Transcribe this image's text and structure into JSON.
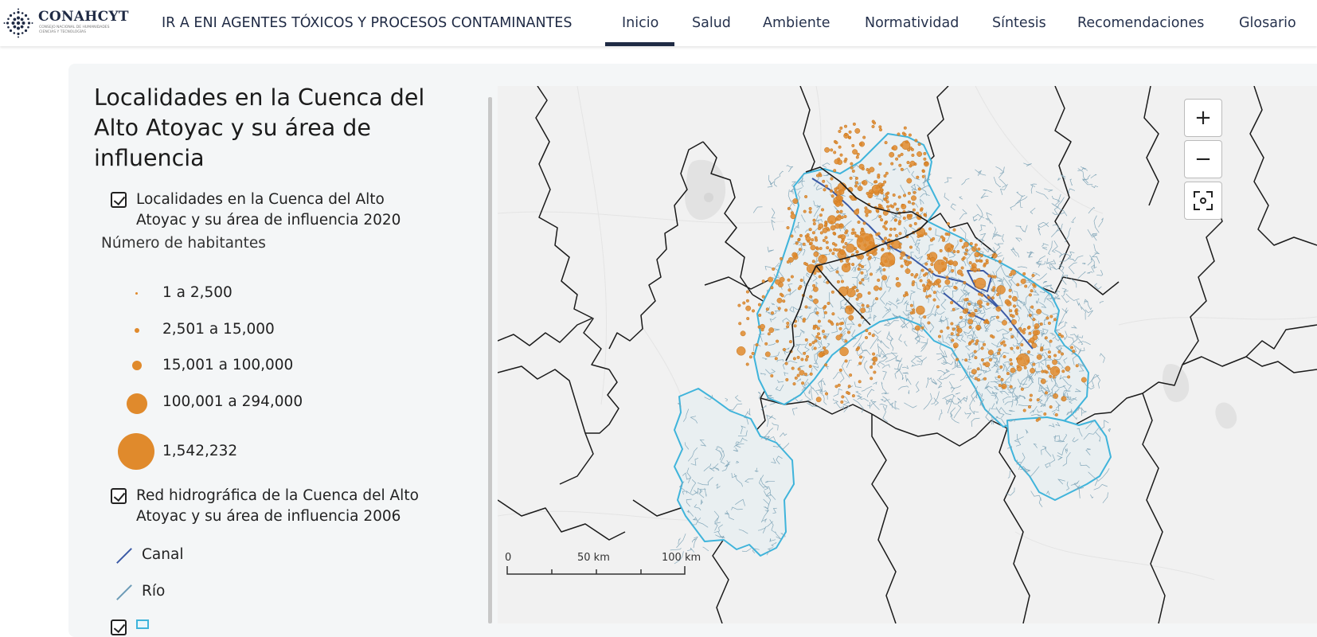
{
  "header": {
    "brand": "CONAHCYT",
    "brand_sub": "CONSEJO NACIONAL DE HUMANIDADES CIENCIAS Y TECNOLOGÍAS",
    "site_title": "IR A ENI AGENTES TÓXICOS Y PROCESOS CONTAMINANTES",
    "nav": [
      "Inicio",
      "Salud",
      "Ambiente",
      "Normatividad",
      "Síntesis",
      "Recomendaciones",
      "Glosario"
    ],
    "active_nav": "Inicio"
  },
  "legend": {
    "title": "Localidades en la Cuenca del Alto Atoyac y su área de influencia",
    "layer1": "Localidades en la Cuenca del Alto Atoyac y su área de influencia 2020",
    "population_header": "Número de habitantes",
    "population_classes": [
      "1 a 2,500",
      "2,501 a 15,000",
      "15,001 a 100,000",
      "100,001 a 294,000",
      "1,542,232"
    ],
    "layer2": "Red hidrográfica de la Cuenca del Alto Atoyac y su área de influencia 2006",
    "line_classes": [
      "Canal",
      "Río"
    ],
    "colors": {
      "localities": "#e08a2c",
      "canal": "#3b5aa6",
      "river": "#6c9bb6",
      "basin": "#3fb4db",
      "boundary": "#1a1a1a"
    }
  },
  "map": {
    "zoom_in": "+",
    "zoom_out": "−",
    "fullscreen_icon": "fullscreen-icon",
    "scale": {
      "start": "0",
      "mid": "50 km",
      "end": "100 km"
    }
  }
}
